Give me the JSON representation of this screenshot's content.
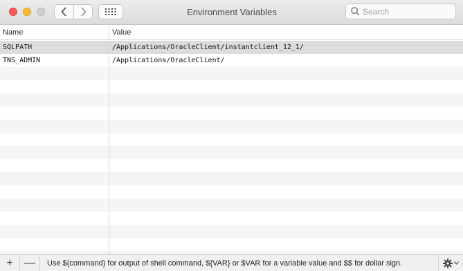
{
  "window": {
    "title": "Environment Variables"
  },
  "search": {
    "placeholder": "Search",
    "value": ""
  },
  "table": {
    "columns": [
      "Name",
      "Value"
    ],
    "rows": [
      {
        "name": "SQLPATH",
        "value": "/Applications/OracleClient/instantclient_12_1/",
        "selected": true
      },
      {
        "name": "TNS_ADMIN",
        "value": "/Applications/OracleClient/",
        "selected": false
      }
    ]
  },
  "footer": {
    "add_label": "+",
    "remove_label": "—",
    "hint": "Use $(command) for output of shell command, ${VAR} or $VAR for a variable value and $$ for dollar sign."
  },
  "icons": {
    "back": "chevron-left-icon",
    "forward": "chevron-right-icon",
    "grid": "grid-icon",
    "search": "search-icon",
    "gear": "gear-icon"
  },
  "colors": {
    "close": "#fd5d57",
    "minimize": "#fdbc2e",
    "zoom_disabled": "#cfcfcf",
    "selected_row": "#dcdcdc",
    "stripe": "#f4f5f5"
  }
}
